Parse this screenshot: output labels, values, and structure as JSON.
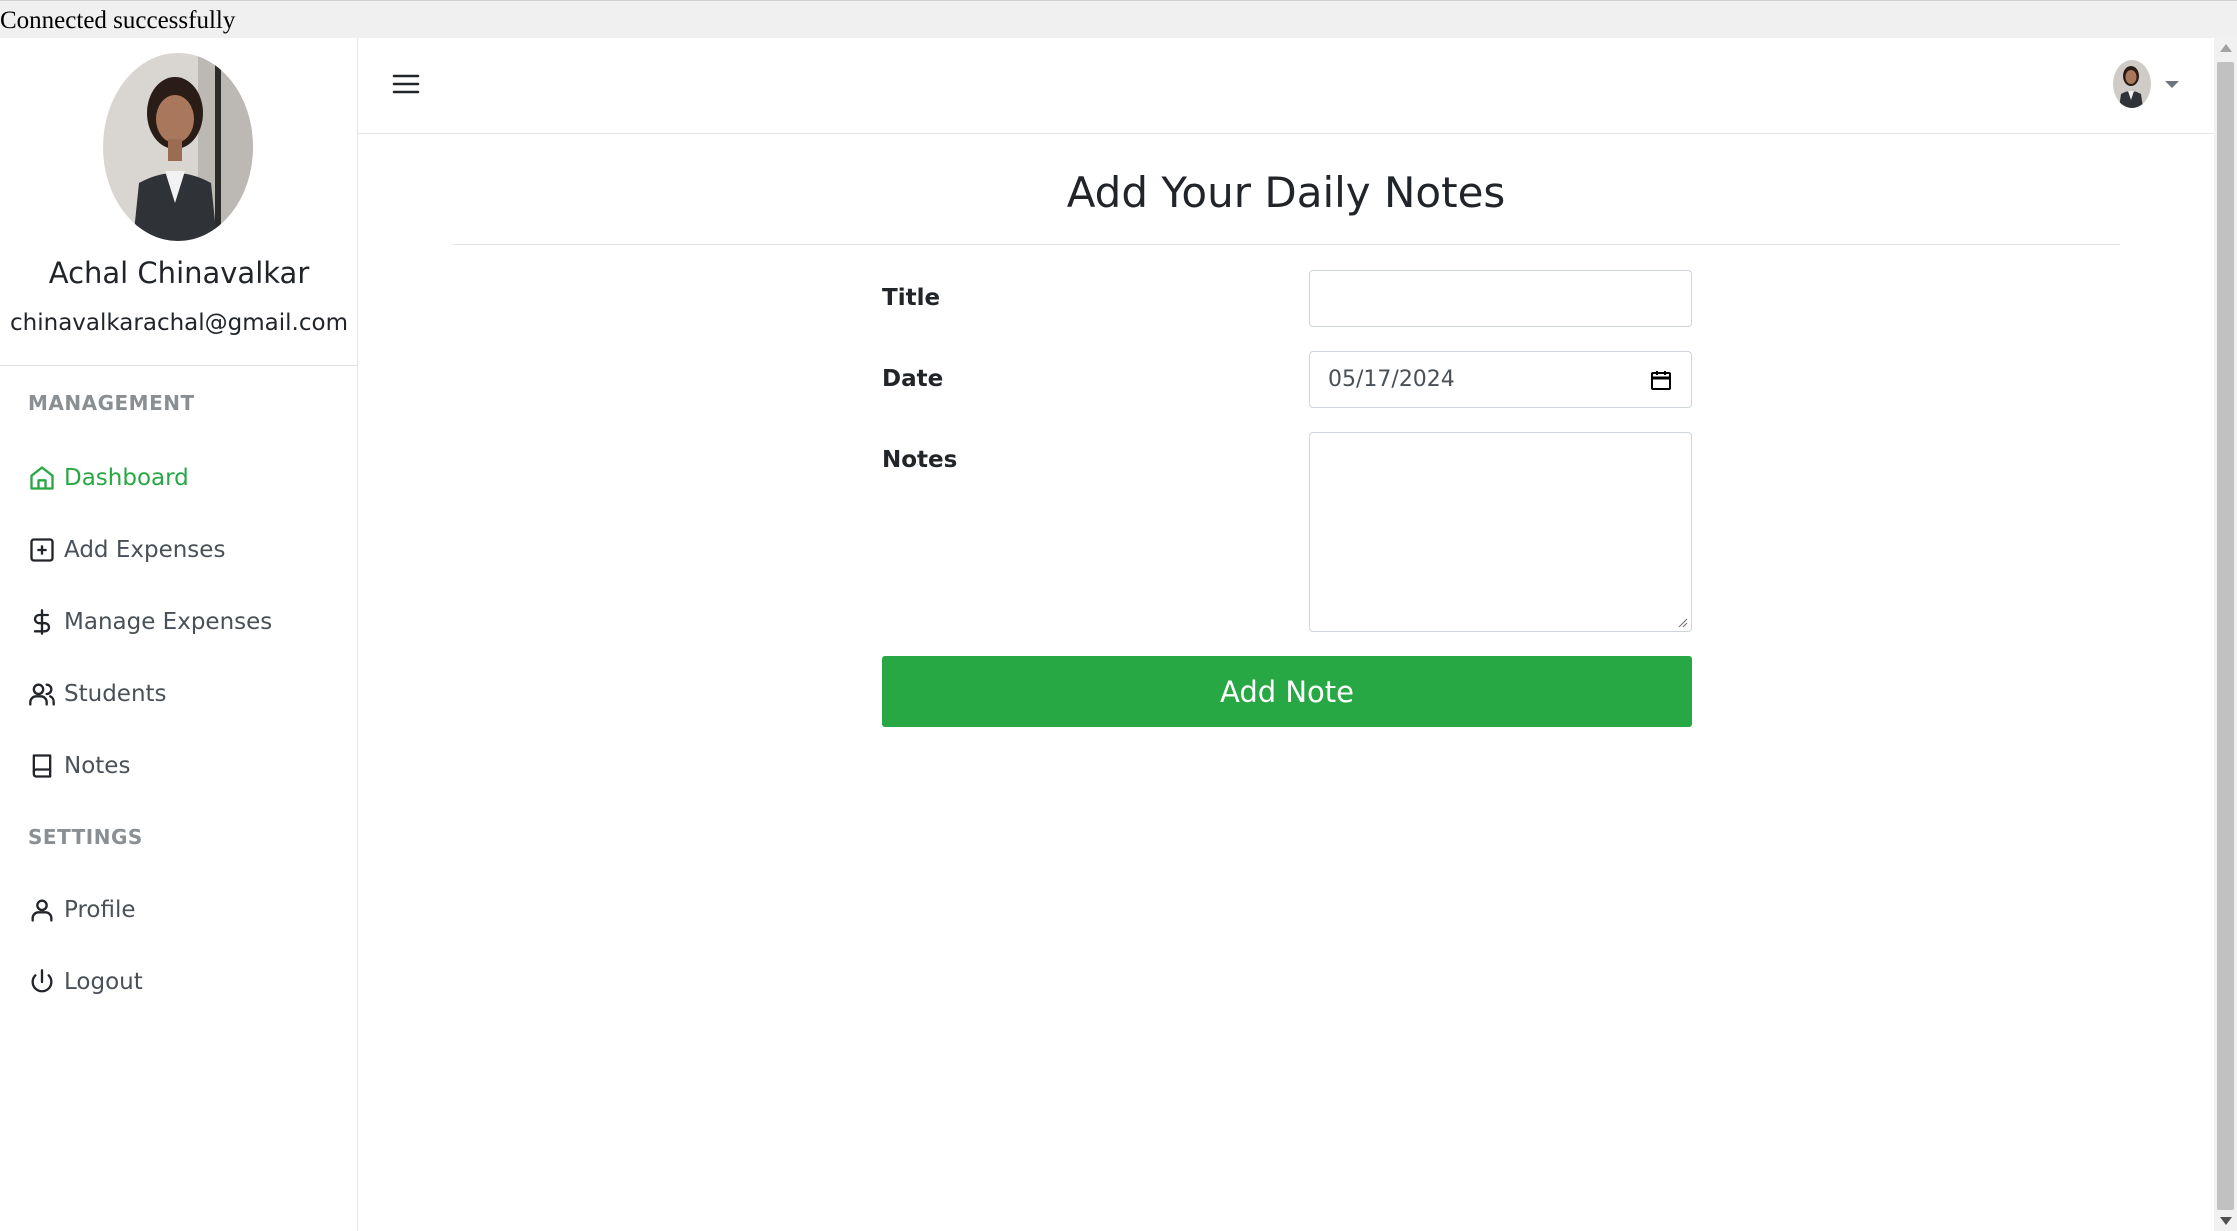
{
  "status": {
    "text": "Connected successfully"
  },
  "sidebar": {
    "user_name": "Achal Chinavalkar",
    "user_email": "chinavalkarachal@gmail.com",
    "sections": [
      {
        "heading": "MANAGEMENT"
      },
      {
        "heading": "SETTINGS"
      }
    ],
    "items": [
      {
        "label": "Dashboard",
        "icon": "home-icon",
        "active": true
      },
      {
        "label": "Add Expenses",
        "icon": "plus-square-icon",
        "active": false
      },
      {
        "label": "Manage Expenses",
        "icon": "dollar-icon",
        "active": false
      },
      {
        "label": "Students",
        "icon": "users-icon",
        "active": false
      },
      {
        "label": "Notes",
        "icon": "book-icon",
        "active": false
      },
      {
        "label": "Profile",
        "icon": "user-icon",
        "active": false
      },
      {
        "label": "Logout",
        "icon": "power-icon",
        "active": false
      }
    ]
  },
  "topbar": {
    "menu_icon": "hamburger-icon",
    "user_menu_icon": "caret-down-icon"
  },
  "main": {
    "title": "Add Your Daily Notes",
    "form": {
      "title_label": "Title",
      "title_value": "",
      "date_label": "Date",
      "date_value": "05/17/2024",
      "notes_label": "Notes",
      "notes_value": "",
      "submit_label": "Add Note"
    }
  },
  "colors": {
    "accent": "#28a745",
    "active_nav": "#28a745",
    "section_heading": "#8a8f94",
    "text": "#212529"
  }
}
